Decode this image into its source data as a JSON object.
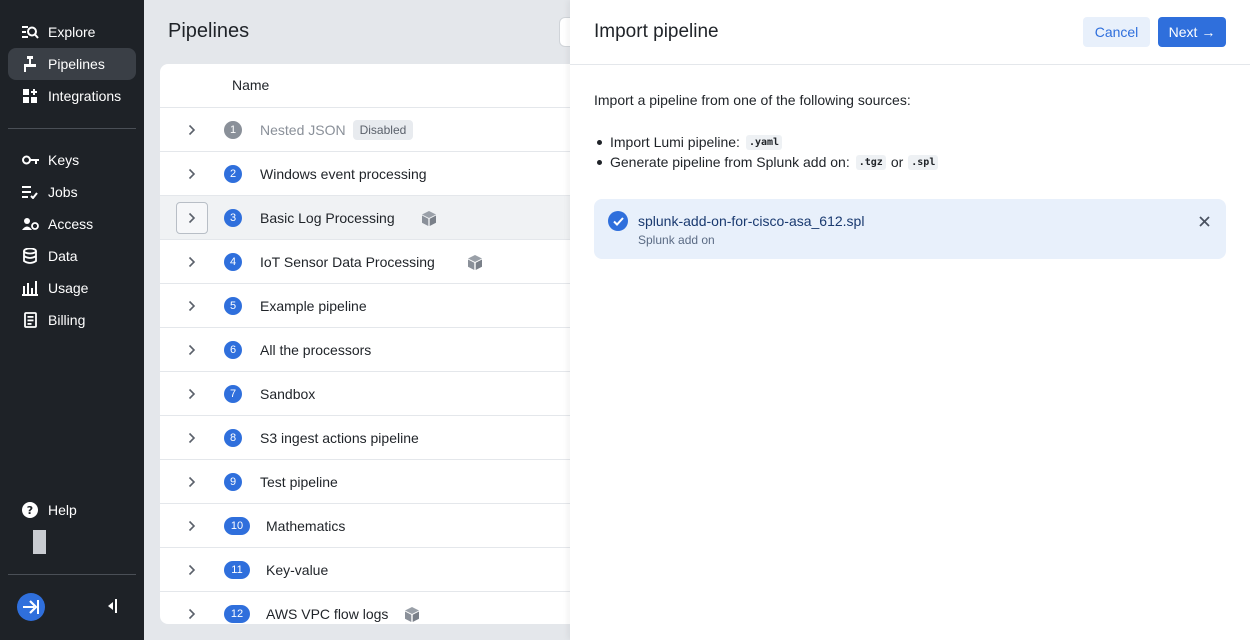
{
  "sidebar": {
    "items": [
      {
        "label": "Explore",
        "icon": "explore-icon"
      },
      {
        "label": "Pipelines",
        "icon": "pipelines-icon"
      },
      {
        "label": "Integrations",
        "icon": "integrations-icon"
      },
      {
        "label": "Keys",
        "icon": "key-icon"
      },
      {
        "label": "Jobs",
        "icon": "jobs-icon"
      },
      {
        "label": "Access",
        "icon": "access-icon"
      },
      {
        "label": "Data",
        "icon": "database-icon"
      },
      {
        "label": "Usage",
        "icon": "bar-chart-icon"
      },
      {
        "label": "Billing",
        "icon": "billing-icon"
      }
    ],
    "help_label": "Help",
    "active": "Pipelines"
  },
  "main": {
    "title": "Pipelines",
    "column_name": "Name",
    "rows": [
      {
        "num": "1",
        "name": "Nested JSON",
        "badge": "Disabled",
        "disabled": true
      },
      {
        "num": "2",
        "name": "Windows event processing"
      },
      {
        "num": "3",
        "name": "Basic Log Processing",
        "package_icon": true,
        "hover": true
      },
      {
        "num": "4",
        "name": "IoT Sensor Data Processing",
        "package_icon": true
      },
      {
        "num": "5",
        "name": "Example pipeline"
      },
      {
        "num": "6",
        "name": "All the processors"
      },
      {
        "num": "7",
        "name": "Sandbox"
      },
      {
        "num": "8",
        "name": "S3 ingest actions pipeline"
      },
      {
        "num": "9",
        "name": "Test pipeline"
      },
      {
        "num": "10",
        "name": "Mathematics"
      },
      {
        "num": "11",
        "name": "Key-value"
      },
      {
        "num": "12",
        "name": "AWS VPC flow logs",
        "package_icon": true
      }
    ]
  },
  "drawer": {
    "title": "Import pipeline",
    "cancel_label": "Cancel",
    "next_label": "Next →",
    "intro": "Import a pipeline from one of the following sources:",
    "bullet1_text": "Import Lumi pipeline:",
    "bullet1_code": ".yaml",
    "bullet2_text": "Generate pipeline from Splunk add on:",
    "bullet2_code1": ".tgz",
    "bullet2_or": "or",
    "bullet2_code2": ".spl",
    "file_name": "splunk-add-on-for-cisco-asa_612.spl",
    "file_type": "Splunk add on"
  },
  "colors": {
    "sidebar_bg": "#1e2227",
    "accent": "#2f6fdc",
    "file_card_bg": "#e8f0fb"
  }
}
